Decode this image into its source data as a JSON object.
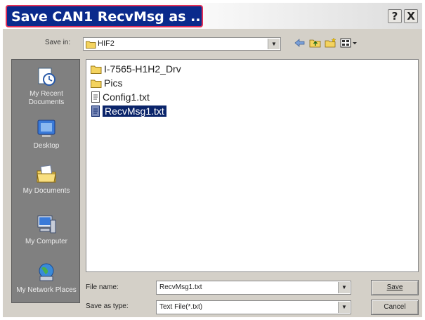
{
  "dialog": {
    "title": "Save CAN1 RecvMsg as ..."
  },
  "titlebar_buttons": {
    "help": "?",
    "close": "X"
  },
  "savein": {
    "label": "Save in:",
    "value": "HIF2"
  },
  "toolbar_icons": [
    "back-arrow-icon",
    "up-folder-icon",
    "new-folder-icon",
    "view-menu-icon"
  ],
  "places": [
    {
      "label": "My Recent Documents",
      "icon": "recent-documents-icon"
    },
    {
      "label": "Desktop",
      "icon": "desktop-icon"
    },
    {
      "label": "My Documents",
      "icon": "my-documents-icon"
    },
    {
      "label": "My Computer",
      "icon": "my-computer-icon"
    },
    {
      "label": "My Network Places",
      "icon": "network-places-icon"
    }
  ],
  "files": [
    {
      "name": "I-7565-H1H2_Drv",
      "icon": "folder-icon"
    },
    {
      "name": "Pics",
      "icon": "folder-icon"
    },
    {
      "name": "Config1.txt",
      "icon": "text-file-icon"
    },
    {
      "name": "RecvMsg1.txt",
      "icon": "text-file-icon",
      "selected": true
    }
  ],
  "filename": {
    "label": "File name:",
    "value": "RecvMsg1.txt"
  },
  "savetype": {
    "label": "Save as type:",
    "value": "Text File(*.txt)"
  },
  "buttons": {
    "save": "Save",
    "cancel": "Cancel"
  },
  "colors": {
    "title_bg": "#0a2a8c",
    "title_highlight_border": "#e12f57",
    "selection": "#0a246a",
    "places_bar": "#808080",
    "dialog_face": "#d4d0c8"
  }
}
